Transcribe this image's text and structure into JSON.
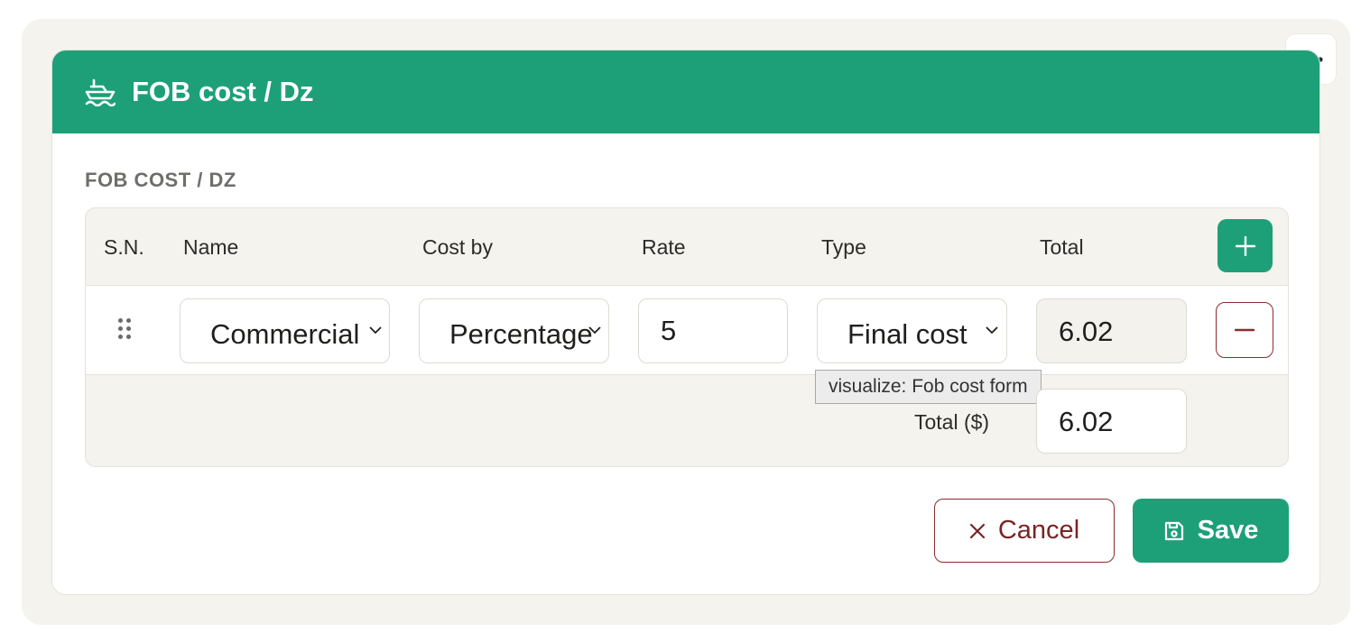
{
  "card": {
    "title": "FOB cost / Dz",
    "header_icon": "ship-icon",
    "section_label": "FOB COST / DZ",
    "more_icon": "more-horizontal-icon"
  },
  "table": {
    "columns": [
      "S.N.",
      "Name",
      "Cost by",
      "Rate",
      "Type",
      "Total"
    ],
    "rows": [
      {
        "name": "Commercial",
        "cost_by": "Percentage",
        "rate": "5",
        "type": "Final cost",
        "total": "6.02"
      }
    ],
    "sum_label": "Total ($)",
    "sum_value": "6.02"
  },
  "tooltip": "visualize: Fob cost form",
  "actions": {
    "cancel_label": "Cancel",
    "save_label": "Save"
  },
  "colors": {
    "accent": "#1da078",
    "danger": "#8b2c2c",
    "panel_bg": "#f4f3ed"
  }
}
